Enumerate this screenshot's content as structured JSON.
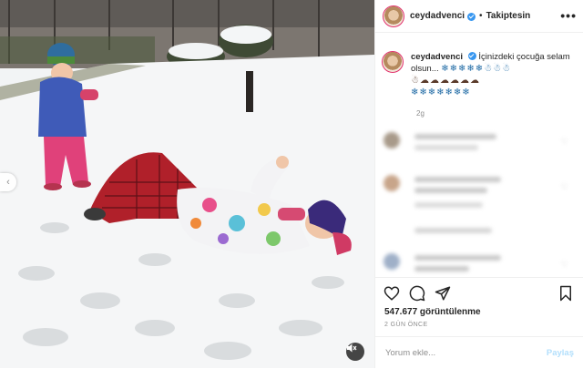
{
  "header": {
    "username": "ceydadvenci",
    "separator": "•",
    "follow_state": "Takiptesin",
    "more_glyph": "•••"
  },
  "caption": {
    "username": "ceydadvenci",
    "text": "İçinizdeki çocuğa selam olsun...",
    "emoji_line1": "❄❄❄❄❄☃☃☃",
    "emoji_line2": "☃☁☁☁☁☁☁",
    "emoji_line3": "❄❄❄❄❄❄❄",
    "time": "2g"
  },
  "actions": {
    "views": "547.677 görüntülenme",
    "posted": "2 GÜN ÖNCE"
  },
  "comment_box": {
    "placeholder": "Yorum ekle...",
    "post_label": "Paylaş"
  },
  "colors": {
    "verified": "#3897f0",
    "link_disabled": "#b2dffc",
    "muted_text": "#8e8e8e"
  },
  "icons": [
    "chevron-left-icon",
    "mute-icon",
    "verified-icon",
    "heart-icon",
    "comment-icon",
    "share-icon",
    "bookmark-icon",
    "more-icon"
  ]
}
